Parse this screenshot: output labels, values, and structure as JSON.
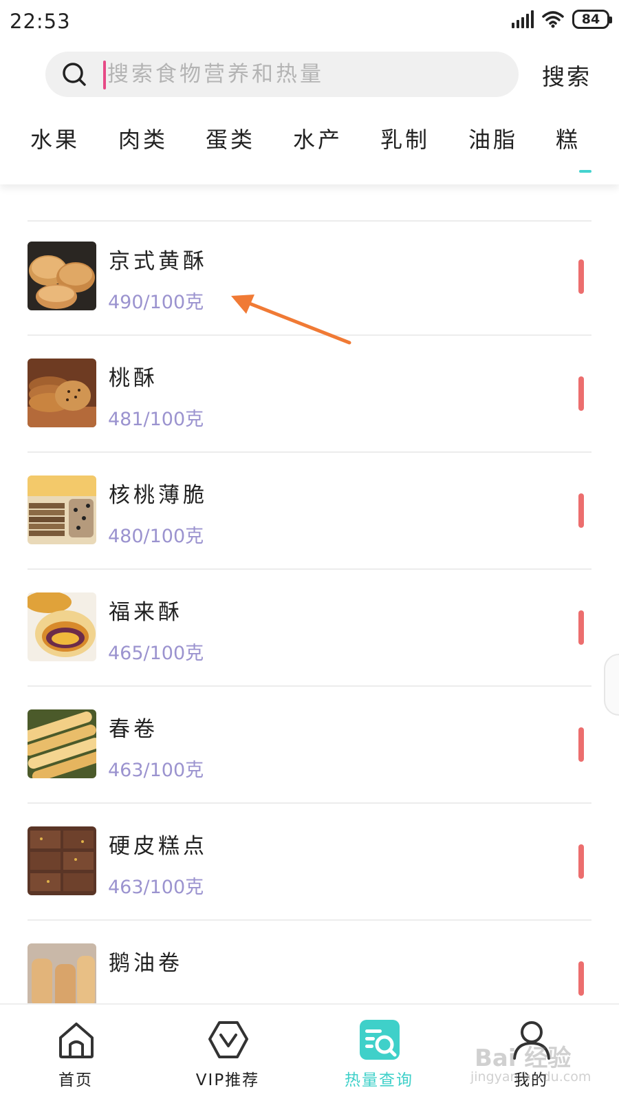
{
  "status_bar": {
    "time": "22:53",
    "battery": "84",
    "icons": [
      "signal-icon",
      "wifi-icon",
      "battery-icon"
    ]
  },
  "search": {
    "placeholder": "搜索食物营养和热量",
    "value": "",
    "button_label": "搜索",
    "icon": "search-icon"
  },
  "category_tabs": {
    "items": [
      {
        "label": "水果"
      },
      {
        "label": "肉类"
      },
      {
        "label": "蛋类"
      },
      {
        "label": "水产"
      },
      {
        "label": "乳制"
      },
      {
        "label": "油脂"
      },
      {
        "label": "糕"
      }
    ],
    "active_index": 6
  },
  "food_list": {
    "items": [
      {
        "name": "京式黄酥",
        "calories": "490/100克"
      },
      {
        "name": "桃酥",
        "calories": "481/100克"
      },
      {
        "name": "核桃薄脆",
        "calories": "480/100克"
      },
      {
        "name": "福来酥",
        "calories": "465/100克"
      },
      {
        "name": "春卷",
        "calories": "463/100克"
      },
      {
        "name": "硬皮糕点",
        "calories": "463/100克"
      },
      {
        "name": "鹅油卷",
        "calories": ""
      }
    ]
  },
  "bottom_nav": {
    "items": [
      {
        "label": "首页",
        "icon": "home-icon"
      },
      {
        "label": "VIP推荐",
        "icon": "vip-icon"
      },
      {
        "label": "热量查询",
        "icon": "calorie-search-icon"
      },
      {
        "label": "我的",
        "icon": "profile-icon"
      }
    ],
    "active_index": 2
  },
  "watermark": {
    "line1": "Bai 经验",
    "line2": "jingyan.baidu.com"
  },
  "colors": {
    "accent": "#3fd0c9",
    "calorie_text": "#9b93cf",
    "calorie_bar": "#ec6e6e",
    "caret": "#e64a86",
    "arrow": "#f07a35"
  }
}
